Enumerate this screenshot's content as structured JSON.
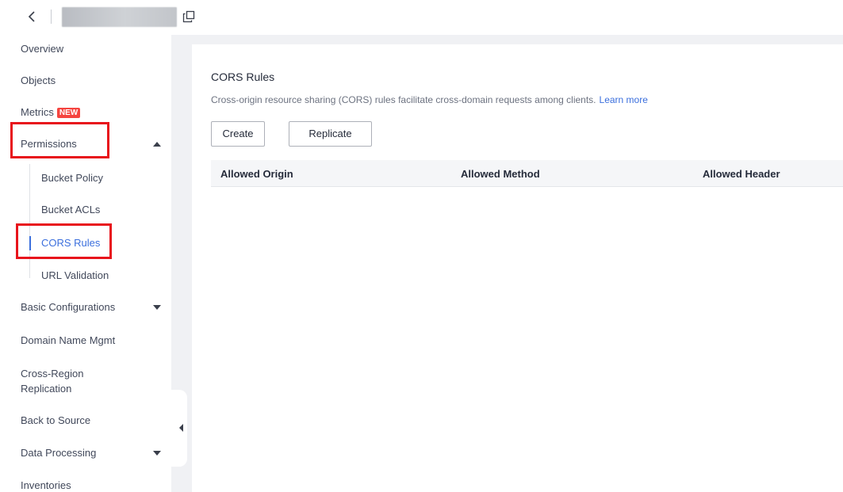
{
  "topbar": {
    "back_icon": "chevron-left-icon",
    "copy_icon": "copy-icon"
  },
  "sidebar": {
    "items": [
      {
        "label": "Overview"
      },
      {
        "label": "Objects"
      },
      {
        "label": "Metrics",
        "badge": "NEW"
      },
      {
        "label": "Permissions",
        "expanded": true
      },
      {
        "label": "Basic Configurations",
        "expanded": false
      },
      {
        "label": "Domain Name Mgmt"
      },
      {
        "label": "Cross-Region Replication",
        "line1": "Cross-Region",
        "line2": "Replication"
      },
      {
        "label": "Back to Source"
      },
      {
        "label": "Data Processing",
        "expanded": false
      },
      {
        "label": "Inventories"
      }
    ],
    "permissions_sub": [
      {
        "label": "Bucket Policy"
      },
      {
        "label": "Bucket ACLs"
      },
      {
        "label": "CORS Rules",
        "active": true
      },
      {
        "label": "URL Validation"
      }
    ]
  },
  "main": {
    "title": "CORS Rules",
    "description": "Cross-origin resource sharing (CORS) rules facilitate cross-domain requests among clients.",
    "learn_more": "Learn more",
    "buttons": {
      "create": "Create",
      "replicate": "Replicate"
    },
    "table_headers": [
      "Allowed Origin",
      "Allowed Method",
      "Allowed Header"
    ]
  },
  "colors": {
    "accent": "#3b6fdd",
    "highlight": "#e8141c",
    "badge": "#f5443f"
  }
}
